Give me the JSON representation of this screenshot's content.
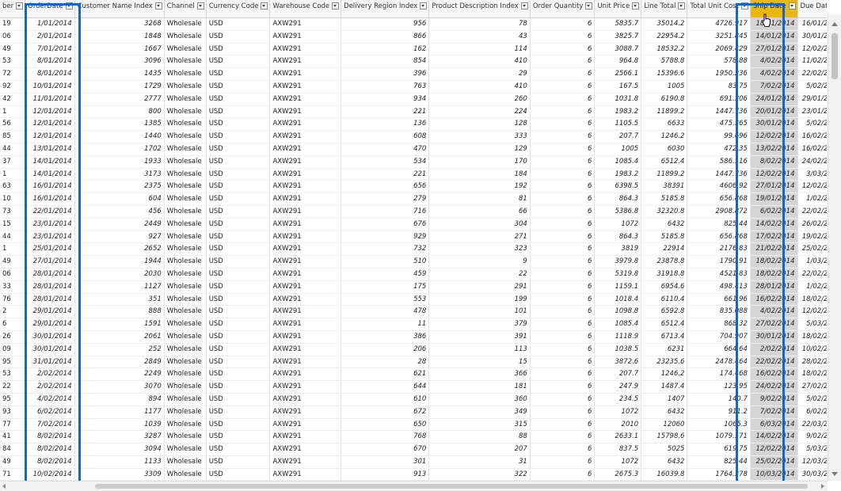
{
  "columns": [
    {
      "label": "ber",
      "key": "number"
    },
    {
      "label": "OrderDate",
      "key": "order_date"
    },
    {
      "label": "Customer Name Index",
      "key": "customer_name_index"
    },
    {
      "label": "Channel",
      "key": "channel"
    },
    {
      "label": "Currency Code",
      "key": "currency_code"
    },
    {
      "label": "Warehouse Code",
      "key": "warehouse_code"
    },
    {
      "label": "Delivery Region Index",
      "key": "delivery_region_index"
    },
    {
      "label": "Product Description Index",
      "key": "product_description_index"
    },
    {
      "label": "Order Quantity",
      "key": "order_quantity"
    },
    {
      "label": "Unit Price",
      "key": "unit_price"
    },
    {
      "label": "Line Total",
      "key": "line_total"
    },
    {
      "label": "Total Unit Cost",
      "key": "total_unit_cost"
    },
    {
      "label": "Ship Date",
      "key": "ship_date"
    },
    {
      "label": "Due Date",
      "key": "due_date"
    }
  ],
  "highlight_color": "#e8b80c",
  "selection_color": "#1566c7",
  "rows": [
    [
      "19",
      "1/01/2014",
      "3268",
      "Wholesale",
      "USD",
      "AXW291",
      "956",
      "78",
      "6",
      "5835.7",
      "35014.2",
      "4726.917",
      "18/01/2014",
      "16/01/2014"
    ],
    [
      "06",
      "2/01/2014",
      "1848",
      "Wholesale",
      "USD",
      "AXW291",
      "866",
      "43",
      "6",
      "3825.7",
      "22954.2",
      "3251.845",
      "14/01/2014",
      "30/01/2014"
    ],
    [
      "49",
      "7/01/2014",
      "1667",
      "Wholesale",
      "USD",
      "AXW291",
      "162",
      "114",
      "6",
      "3088.7",
      "18532.2",
      "2069.429",
      "27/01/2014",
      "12/02/2014"
    ],
    [
      "53",
      "8/01/2014",
      "3096",
      "Wholesale",
      "USD",
      "AXW291",
      "854",
      "410",
      "6",
      "964.8",
      "5788.8",
      "578.88",
      "4/02/2014",
      "11/02/2014"
    ],
    [
      "72",
      "8/01/2014",
      "1435",
      "Wholesale",
      "USD",
      "AXW291",
      "396",
      "29",
      "6",
      "2566.1",
      "15396.6",
      "1950.236",
      "4/02/2014",
      "22/02/2014"
    ],
    [
      "92",
      "10/01/2014",
      "1729",
      "Wholesale",
      "USD",
      "AXW291",
      "763",
      "410",
      "6",
      "167.5",
      "1005",
      "83.75",
      "7/02/2014",
      "5/02/2014"
    ],
    [
      "42",
      "11/01/2014",
      "2777",
      "Wholesale",
      "USD",
      "AXW291",
      "934",
      "260",
      "6",
      "1031.8",
      "6190.8",
      "691.306",
      "24/01/2014",
      "29/01/2014"
    ],
    [
      "1",
      "12/01/2014",
      "800",
      "Wholesale",
      "USD",
      "AXW291",
      "221",
      "224",
      "6",
      "1983.2",
      "11899.2",
      "1447.736",
      "20/01/2014",
      "23/01/2014"
    ],
    [
      "56",
      "12/01/2014",
      "1385",
      "Wholesale",
      "USD",
      "AXW291",
      "136",
      "128",
      "6",
      "1105.5",
      "6633",
      "475.365",
      "30/01/2014",
      "5/02/2014"
    ],
    [
      "85",
      "12/01/2014",
      "1440",
      "Wholesale",
      "USD",
      "AXW291",
      "608",
      "333",
      "6",
      "207.7",
      "1246.2",
      "99.696",
      "12/02/2014",
      "16/02/2014"
    ],
    [
      "44",
      "13/01/2014",
      "1702",
      "Wholesale",
      "USD",
      "AXW291",
      "470",
      "129",
      "6",
      "1005",
      "6030",
      "472.35",
      "13/02/2014",
      "16/02/2014"
    ],
    [
      "37",
      "14/01/2014",
      "1933",
      "Wholesale",
      "USD",
      "AXW291",
      "534",
      "170",
      "6",
      "1085.4",
      "6512.4",
      "586.116",
      "8/02/2014",
      "24/02/2014"
    ],
    [
      "1",
      "14/01/2014",
      "3173",
      "Wholesale",
      "USD",
      "AXW291",
      "221",
      "184",
      "6",
      "1983.2",
      "11899.2",
      "1447.736",
      "12/02/2014",
      "3/03/2014"
    ],
    [
      "63",
      "16/01/2014",
      "2375",
      "Wholesale",
      "USD",
      "AXW291",
      "656",
      "192",
      "6",
      "6398.5",
      "38391",
      "4606.92",
      "27/01/2014",
      "12/02/2014"
    ],
    [
      "10",
      "16/01/2014",
      "604",
      "Wholesale",
      "USD",
      "AXW291",
      "279",
      "81",
      "6",
      "864.3",
      "5185.8",
      "656.868",
      "19/01/2014",
      "1/02/2014"
    ],
    [
      "73",
      "22/01/2014",
      "456",
      "Wholesale",
      "USD",
      "AXW291",
      "716",
      "66",
      "6",
      "5386.8",
      "32320.8",
      "2908.872",
      "6/02/2014",
      "22/02/2014"
    ],
    [
      "15",
      "23/01/2014",
      "2449",
      "Wholesale",
      "USD",
      "AXW291",
      "676",
      "304",
      "6",
      "1072",
      "6432",
      "825.44",
      "14/02/2014",
      "26/02/2014"
    ],
    [
      "44",
      "23/01/2014",
      "927",
      "Wholesale",
      "USD",
      "AXW291",
      "929",
      "271",
      "6",
      "864.3",
      "5185.8",
      "656.868",
      "17/02/2014",
      "19/02/2014"
    ],
    [
      "1",
      "25/01/2014",
      "2652",
      "Wholesale",
      "USD",
      "AXW291",
      "732",
      "323",
      "6",
      "3819",
      "22914",
      "2176.83",
      "21/02/2014",
      "25/02/2014"
    ],
    [
      "49",
      "27/01/2014",
      "1944",
      "Wholesale",
      "USD",
      "AXW291",
      "510",
      "9",
      "6",
      "3979.8",
      "23878.8",
      "1790.91",
      "18/02/2014",
      "1/03/2014"
    ],
    [
      "06",
      "28/01/2014",
      "2030",
      "Wholesale",
      "USD",
      "AXW291",
      "459",
      "22",
      "6",
      "5319.8",
      "31918.8",
      "4521.83",
      "18/02/2014",
      "22/02/2014"
    ],
    [
      "33",
      "28/01/2014",
      "1127",
      "Wholesale",
      "USD",
      "AXW291",
      "175",
      "291",
      "6",
      "1159.1",
      "6954.6",
      "498.413",
      "28/01/2014",
      "1/02/2014"
    ],
    [
      "76",
      "28/01/2014",
      "351",
      "Wholesale",
      "USD",
      "AXW291",
      "553",
      "199",
      "6",
      "1018.4",
      "6110.4",
      "661.96",
      "16/02/2014",
      "18/02/2014"
    ],
    [
      "2",
      "29/01/2014",
      "888",
      "Wholesale",
      "USD",
      "AXW291",
      "478",
      "101",
      "6",
      "1098.8",
      "6592.8",
      "835.088",
      "4/02/2014",
      "12/02/2014"
    ],
    [
      "6",
      "29/01/2014",
      "1591",
      "Wholesale",
      "USD",
      "AXW291",
      "11",
      "379",
      "6",
      "1085.4",
      "6512.4",
      "868.32",
      "27/02/2014",
      "5/03/2014"
    ],
    [
      "26",
      "30/01/2014",
      "2061",
      "Wholesale",
      "USD",
      "AXW291",
      "386",
      "391",
      "6",
      "1118.9",
      "6713.4",
      "704.907",
      "30/01/2014",
      "18/02/2014"
    ],
    [
      "09",
      "30/01/2014",
      "252",
      "Wholesale",
      "USD",
      "AXW291",
      "206",
      "113",
      "6",
      "1038.5",
      "6231",
      "664.64",
      "2/02/2014",
      "10/02/2014"
    ],
    [
      "95",
      "31/01/2014",
      "2849",
      "Wholesale",
      "USD",
      "AXW291",
      "28",
      "15",
      "6",
      "3872.6",
      "23235.6",
      "2478.464",
      "22/02/2014",
      "28/02/2014"
    ],
    [
      "53",
      "2/02/2014",
      "2249",
      "Wholesale",
      "USD",
      "AXW291",
      "621",
      "366",
      "6",
      "207.7",
      "1246.2",
      "174.468",
      "16/02/2014",
      "18/02/2014"
    ],
    [
      "22",
      "2/02/2014",
      "3070",
      "Wholesale",
      "USD",
      "AXW291",
      "644",
      "181",
      "6",
      "247.9",
      "1487.4",
      "123.95",
      "24/02/2014",
      "27/02/2014"
    ],
    [
      "95",
      "4/02/2014",
      "894",
      "Wholesale",
      "USD",
      "AXW291",
      "610",
      "360",
      "6",
      "234.5",
      "1407",
      "140.7",
      "9/02/2014",
      "5/02/2014"
    ],
    [
      "93",
      "6/02/2014",
      "1177",
      "Wholesale",
      "USD",
      "AXW291",
      "672",
      "349",
      "6",
      "1072",
      "6432",
      "911.2",
      "7/02/2014",
      "6/02/2014"
    ],
    [
      "77",
      "7/02/2014",
      "1039",
      "Wholesale",
      "USD",
      "AXW291",
      "650",
      "315",
      "6",
      "2010",
      "12060",
      "1065.3",
      "6/03/2014",
      "22/03/2014"
    ],
    [
      "41",
      "8/02/2014",
      "3287",
      "Wholesale",
      "USD",
      "AXW291",
      "768",
      "88",
      "6",
      "2633.1",
      "15798.6",
      "1079.571",
      "14/02/2014",
      "9/02/2014"
    ],
    [
      "84",
      "8/02/2014",
      "3094",
      "Wholesale",
      "USD",
      "AXW291",
      "670",
      "207",
      "6",
      "837.5",
      "5025",
      "619.75",
      "12/02/2014",
      "5/03/2014"
    ],
    [
      "49",
      "8/02/2014",
      "1133",
      "Wholesale",
      "USD",
      "AXW291",
      "301",
      "31",
      "6",
      "1072",
      "6432",
      "825.44",
      "25/02/2014",
      "12/03/2014"
    ],
    [
      "71",
      "10/02/2014",
      "3309",
      "Wholesale",
      "USD",
      "AXW291",
      "913",
      "322",
      "6",
      "2675.3",
      "16039.8",
      "1764.378",
      "10/03/2014",
      "30/03/2014"
    ]
  ]
}
